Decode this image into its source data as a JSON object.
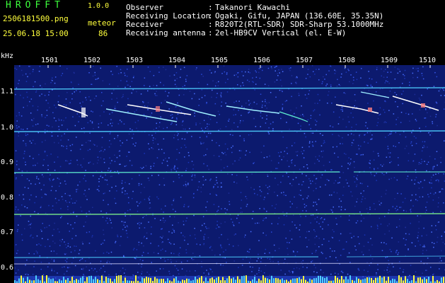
{
  "header": {
    "app_name": "HROFFT",
    "version": "1.0.0",
    "filename": "2506181500.png",
    "datetime": "25.06.18 15:00",
    "meteor_label": "meteor",
    "meteor_count": "86"
  },
  "info": [
    {
      "key": "Observer",
      "value": "Takanori Kawachi"
    },
    {
      "key": "Receiving Location",
      "value": "Ogaki, Gifu, JAPAN (136.60E, 35.35N)"
    },
    {
      "key": "Receiver",
      "value": "R820T2(RTL-SDR) SDR-Sharp 53.1000MHz"
    },
    {
      "key": "Receiving antenna",
      "value": "2el-HB9CV Vertical (el. E-W)"
    }
  ],
  "axis": {
    "unit": "kHz",
    "y_ticks": [
      "1.1",
      "1.0",
      "0.9",
      "0.8",
      "0.7",
      "0.6"
    ],
    "x_ticks": [
      "1501",
      "1502",
      "1503",
      "1504",
      "1505",
      "1506",
      "1507",
      "1508",
      "1509",
      "1510"
    ]
  },
  "colors": {
    "background": "#0c1a6e",
    "noise": "#2a4ad8",
    "carrier": "#4fd0ff",
    "meteor": "#ffffff",
    "text_green": "#3cff3c",
    "text_yellow": "#ffff3c"
  }
}
